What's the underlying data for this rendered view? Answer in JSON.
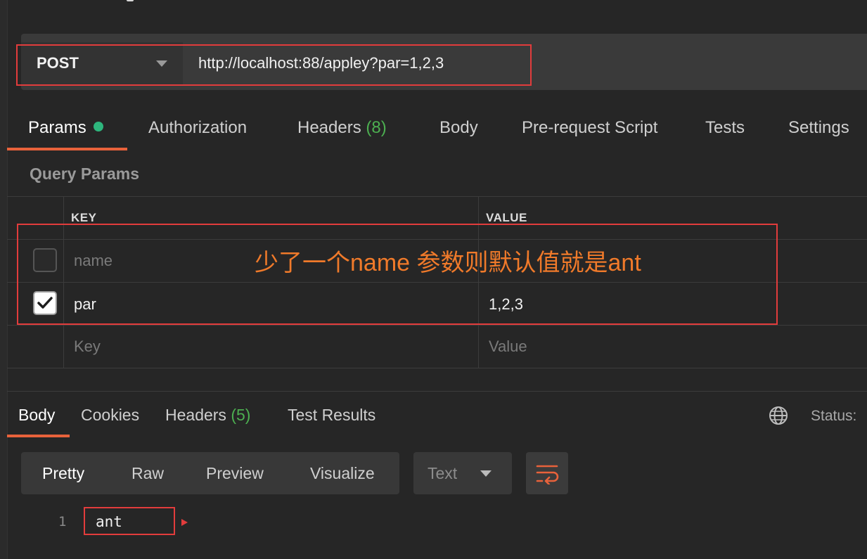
{
  "request": {
    "method": "POST",
    "url": "http://localhost:88/appley?par=1,2,3"
  },
  "request_tabs": {
    "params": "Params",
    "authorization": "Authorization",
    "headers": "Headers",
    "headers_count": "(8)",
    "body": "Body",
    "pre_request": "Pre-request Script",
    "tests": "Tests",
    "settings": "Settings"
  },
  "query_params": {
    "title": "Query Params",
    "key_header": "KEY",
    "value_header": "VALUE",
    "rows": [
      {
        "key": "name",
        "value": "",
        "checked": false
      },
      {
        "key": "par",
        "value": "1,2,3",
        "checked": true
      }
    ],
    "key_placeholder": "Key",
    "value_placeholder": "Value"
  },
  "annotation": "少了一个name 参数则默认值就是ant",
  "response_tabs": {
    "body": "Body",
    "cookies": "Cookies",
    "headers": "Headers",
    "headers_count": "(5)",
    "test_results": "Test Results",
    "status_label": "Status:"
  },
  "view_modes": {
    "pretty": "Pretty",
    "raw": "Raw",
    "preview": "Preview",
    "visualize": "Visualize",
    "format": "Text"
  },
  "response_body": {
    "line_number": "1",
    "text": "ant"
  },
  "icons": {
    "globe": "globe-icon",
    "wrap": "wrap-lines-icon",
    "check": "checkmark-icon",
    "chevron": "chevron-down-icon"
  },
  "colors": {
    "accent": "#e8623b",
    "highlight_box": "#e23c3c",
    "annotation": "#f07a2a",
    "count_green": "#4caf50",
    "status_dot": "#2eb67d"
  }
}
